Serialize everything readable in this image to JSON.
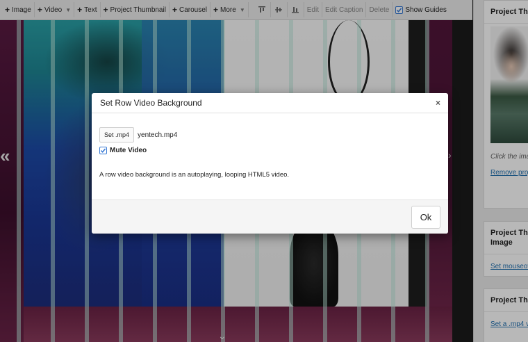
{
  "toolbar": {
    "image": "Image",
    "video": "Video",
    "text": "Text",
    "project_thumbnail": "Project Thumbnail",
    "carousel": "Carousel",
    "more": "More",
    "edit": "Edit",
    "edit_caption": "Edit Caption",
    "delete": "Delete",
    "show_guides": "Show Guides",
    "show_guides_checked": true
  },
  "stage": {
    "arrow_left": "«",
    "arrow_right": "›",
    "arrow_down": "⌄"
  },
  "modal": {
    "title": "Set Row Video Background",
    "close": "×",
    "set_button": "Set .mp4",
    "file_name": "yentech.mp4",
    "mute_label": "Mute Video",
    "mute_checked": true,
    "help_text": "A row video background is an autoplaying, looping HTML5 video.",
    "ok_button": "Ok"
  },
  "sidebar": {
    "panel1_title": "Project Thu",
    "panel1_note": "Click the ima",
    "panel1_link": "Remove proj",
    "panel2_title_line1": "Project Thu",
    "panel2_title_line2": "Image",
    "panel2_link": "Set mouseov",
    "panel3_title": "Project Thu",
    "panel3_link": "Set a .mp4 v"
  },
  "colors": {
    "accent": "#3a7bd5",
    "link": "#2271b1",
    "guide": "#bce8da"
  }
}
